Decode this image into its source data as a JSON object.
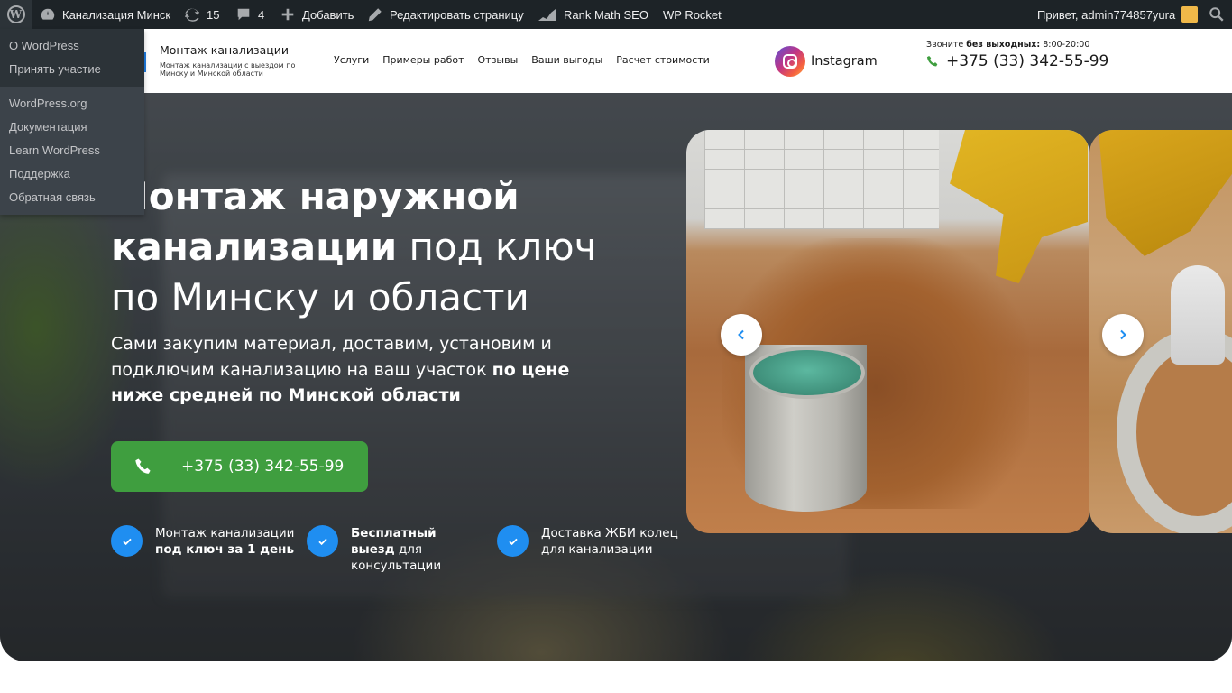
{
  "adminbar": {
    "site_name": "Канализация Минск",
    "updates_count": "15",
    "comments_count": "4",
    "add_label": "Добавить",
    "edit_label": "Редактировать страницу",
    "rankmath_label": "Rank Math SEO",
    "wprocket_label": "WP Rocket",
    "greeting": "Привет, admin774857yura"
  },
  "wp_menu": {
    "group1": [
      "О WordPress",
      "Принять участие"
    ],
    "group2": [
      "WordPress.org",
      "Документация",
      "Learn WordPress",
      "Поддержка",
      "Обратная связь"
    ]
  },
  "header": {
    "brand_title": "Монтаж канализации",
    "brand_subtitle": "Монтаж канализации с выездом по Минску и Минской области",
    "nav": [
      "Услуги",
      "Примеры работ",
      "Отзывы",
      "Ваши выгоды",
      "Расчет стоимости"
    ],
    "instagram_label": "Instagram",
    "call_note_prefix": "Звоните",
    "call_note_bold": "без выходных:",
    "call_hours": "8:00-20:00",
    "phone": "+375 (33) 342-55-99"
  },
  "hero": {
    "title_bold_1": "Монтаж наружной",
    "title_bold_2": "канализации",
    "title_regular_1": " под ключ",
    "title_regular_2": "по Минску и области",
    "subtitle_regular": "Сами закупим материал, доставим, установим и подключим канализацию на ваш участок ",
    "subtitle_bold": "по цене ниже средней по Минской области",
    "cta_phone": "+375 (33) 342-55-99",
    "features": [
      {
        "line1": "Монтаж канализации",
        "bold": "под ключ за 1 день",
        "rest": ""
      },
      {
        "line1": "",
        "bold": "Бесплатный выезд",
        "rest": " для консультации"
      },
      {
        "line1": "Доставка ЖБИ колец",
        "bold": "",
        "rest": "для канализации"
      }
    ]
  },
  "colors": {
    "adminbar_bg": "#1d2327",
    "cta_green": "#3f9e3f",
    "check_blue": "#1f8ef1",
    "slider_arrow_blue": "#1f8ef1"
  },
  "icons": [
    "wordpress-logo-icon",
    "dashboard-icon",
    "updates-icon",
    "comments-icon",
    "plus-icon",
    "pencil-icon",
    "rankmath-icon",
    "search-icon",
    "instagram-icon",
    "phone-icon",
    "check-icon",
    "chevron-left-icon",
    "chevron-right-icon"
  ]
}
